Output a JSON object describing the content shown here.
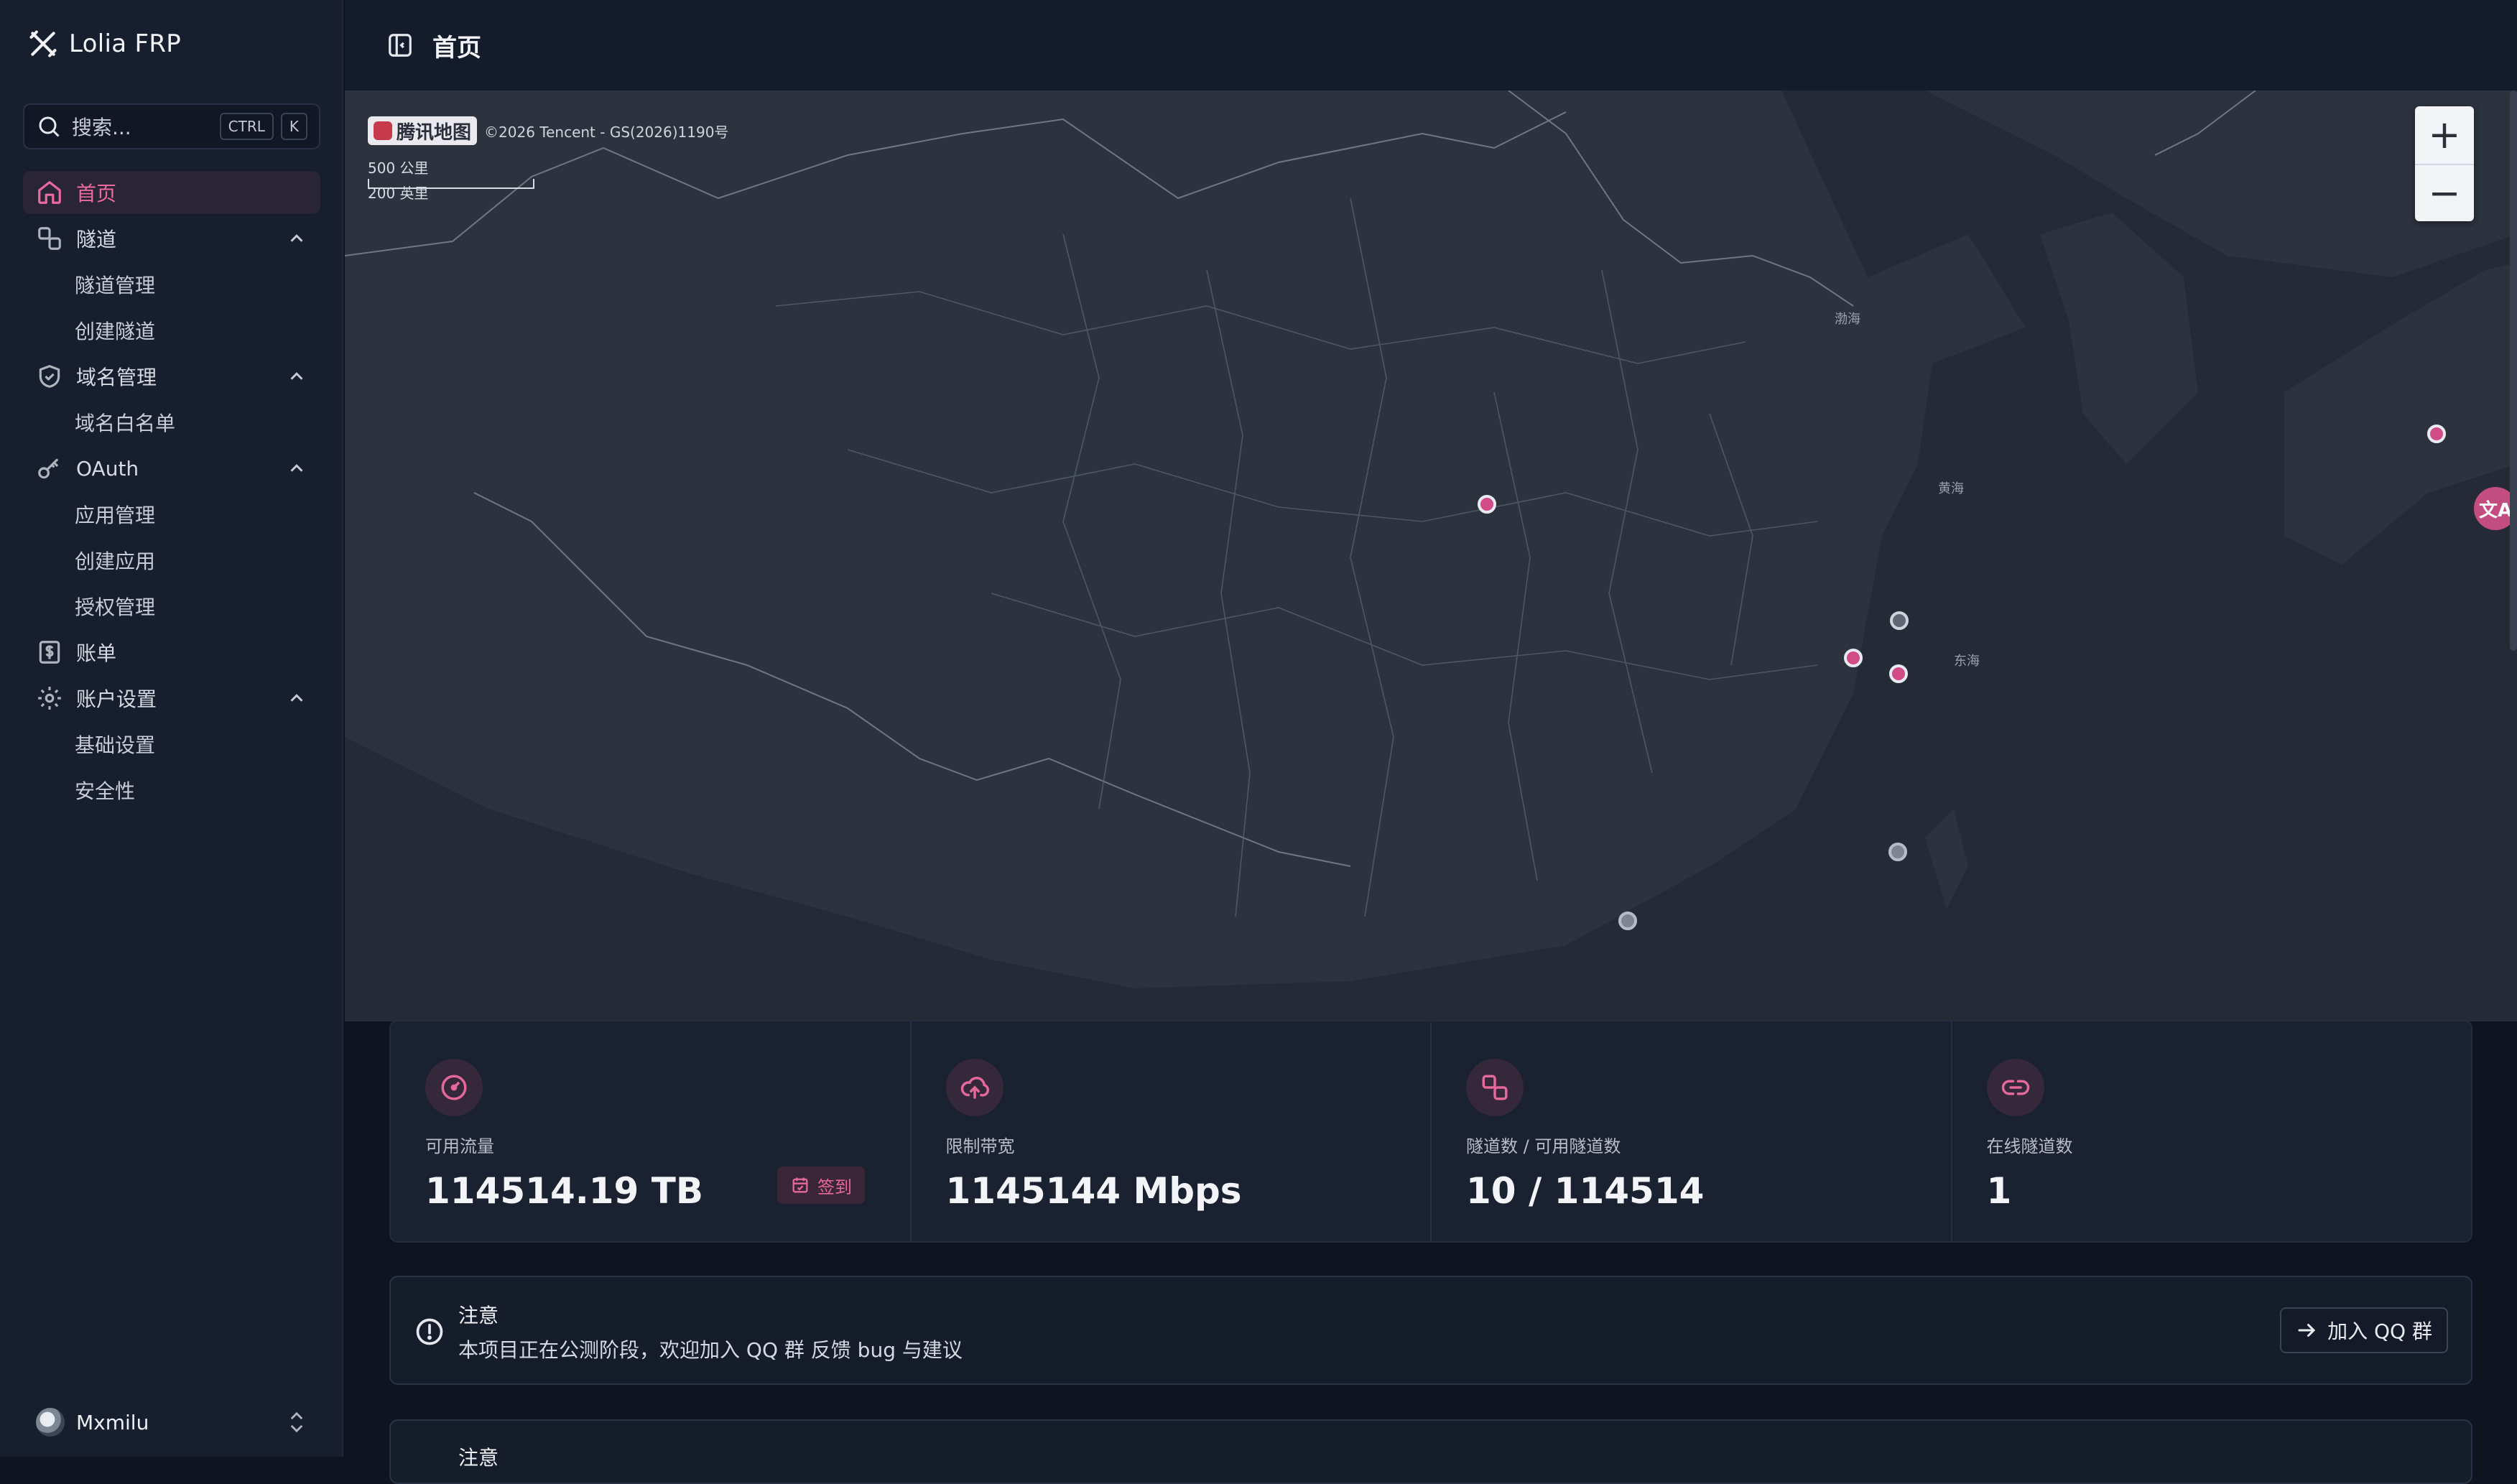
{
  "app": {
    "name": "Lolia FRP"
  },
  "search": {
    "placeholder": "搜索...",
    "kbd1": "CTRL",
    "kbd2": "K"
  },
  "sidebar": {
    "home": "首页",
    "tunnel": "隧道",
    "tunnel_manage": "隧道管理",
    "tunnel_create": "创建隧道",
    "domain": "域名管理",
    "domain_whitelist": "域名白名单",
    "oauth": "OAuth",
    "app_manage": "应用管理",
    "app_create": "创建应用",
    "auth_manage": "授权管理",
    "bill": "账单",
    "account": "账户设置",
    "basic": "基础设置",
    "security": "安全性"
  },
  "user": {
    "name": "Mxmilu"
  },
  "header": {
    "title": "首页"
  },
  "map": {
    "provider": "腾讯地图",
    "copyright": "©2026 Tencent - GS(2026)1190号",
    "scale_km": "500 公里",
    "scale_mi": "200 英里",
    "sea_bohai": "渤海",
    "sea_huanghai": "黄海",
    "sea_donghai": "东海",
    "zoom_in": "+",
    "zoom_out": "−"
  },
  "stats": [
    {
      "label": "可用流量",
      "value": "114514.19 TB"
    },
    {
      "label": "限制带宽",
      "value": "1145144 Mbps"
    },
    {
      "label": "隧道数 / 可用隧道数",
      "value": "10 / 114514"
    },
    {
      "label": "在线隧道数",
      "value": "1"
    }
  ],
  "checkin": {
    "label": "签到"
  },
  "notices": [
    {
      "title": "注意",
      "text": "本项目正在公测阶段，欢迎加入 QQ 群 反馈 bug 与建议",
      "button": "加入 QQ 群"
    },
    {
      "title": "注意"
    }
  ],
  "colors": {
    "accent": "#e46899",
    "sidebar": "#171e2d",
    "bg": "#0f1420"
  }
}
